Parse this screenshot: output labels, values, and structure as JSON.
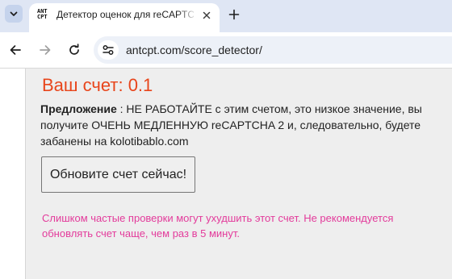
{
  "browser": {
    "tab": {
      "favicon_text": "ANT CPT",
      "title": "Детектор оценок для reCAPTCHA"
    },
    "address_bar": {
      "url": "antcpt.com/score_detector/"
    },
    "icons": {
      "tab_list": "chevron-down-icon",
      "close": "close-icon",
      "new_tab": "plus-icon",
      "back": "arrow-left-icon",
      "forward": "arrow-right-icon",
      "reload": "reload-icon",
      "site_info": "tune-icon"
    }
  },
  "page": {
    "score_heading": "Ваш счет: 0.1",
    "suggestion_label": "Предложение",
    "suggestion_text": " : НЕ РАБОТАЙТЕ с этим счетом, это низкое значение, вы получите ОЧЕНЬ МЕДЛЕННУЮ reCAPTCHA 2 и, следовательно, будете забанены на kolotibablo.com",
    "refresh_button": "Обновите счет сейчас!",
    "warning": "Слишком частые проверки могут ухудшить этот счет. Не рекомендуется обновлять счет чаще, чем раз в 5 минут."
  },
  "colors": {
    "score": "#e8451b",
    "warning": "#e33b9b",
    "tabbar": "#dfe6f4"
  }
}
